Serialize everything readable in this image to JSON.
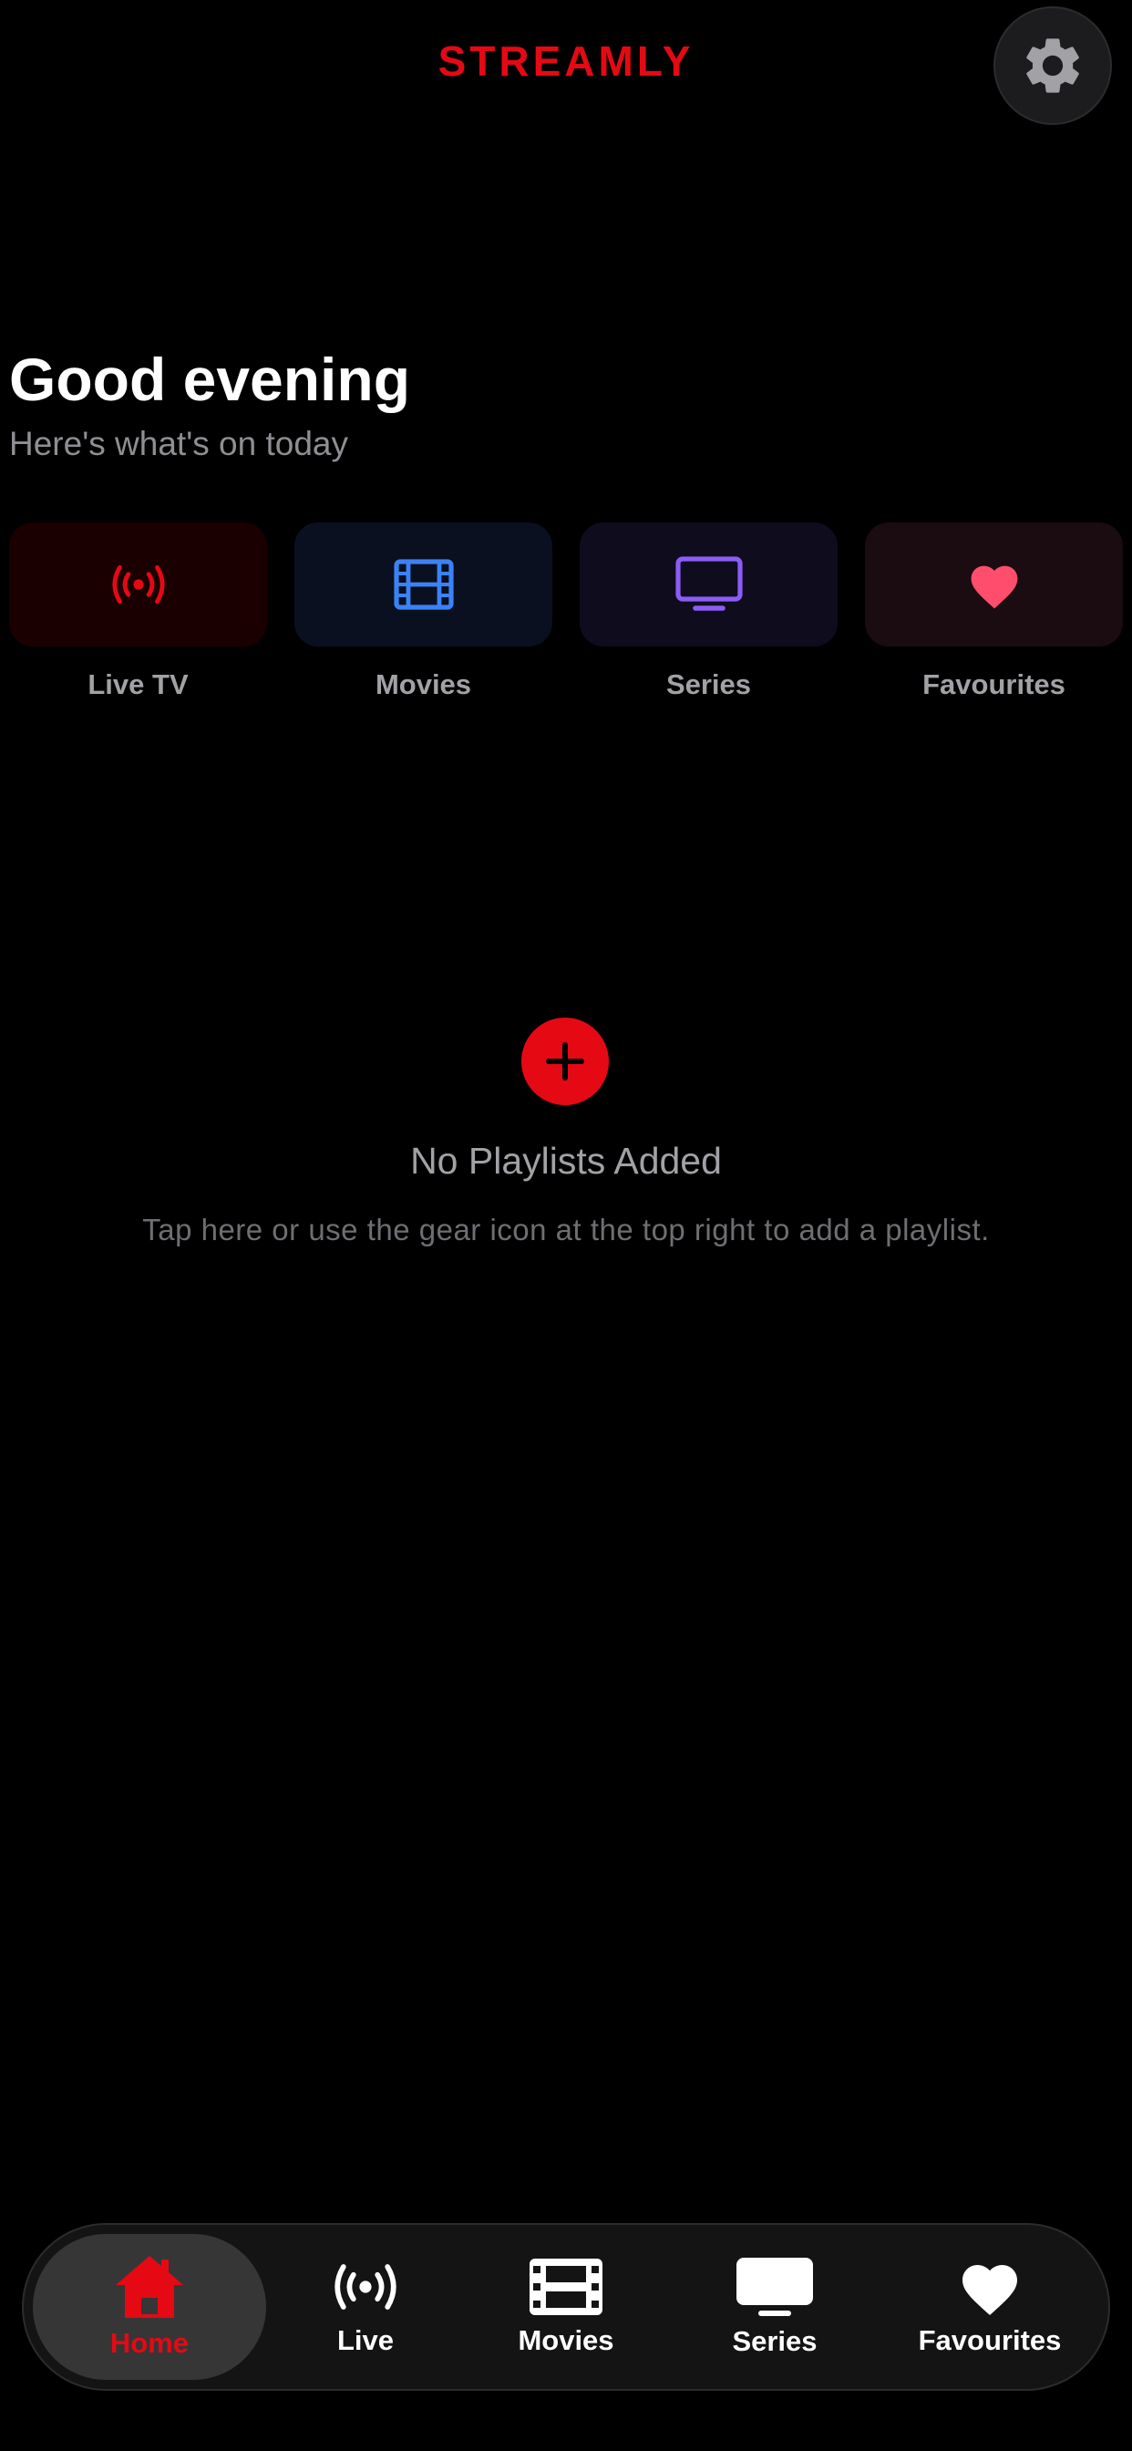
{
  "header": {
    "brand": "STREAMLY",
    "settings_icon": "gear-icon"
  },
  "greeting": {
    "title": "Good evening",
    "subtitle": "Here's what's on today"
  },
  "categories": [
    {
      "label": "Live TV",
      "icon": "broadcast-icon",
      "color": "#e50914",
      "bg": "#1a0000"
    },
    {
      "label": "Movies",
      "icon": "film-icon",
      "color": "#3b82f6",
      "bg": "#0a1020"
    },
    {
      "label": "Series",
      "icon": "tv-icon",
      "color": "#8b5cf6",
      "bg": "#0f0c1e"
    },
    {
      "label": "Favourites",
      "icon": "heart-icon",
      "color": "#ff4d6d",
      "bg": "#1a0c10"
    }
  ],
  "empty_state": {
    "icon": "plus-icon",
    "title": "No Playlists Added",
    "message": "Tap here or use the gear icon at the top right to add a playlist."
  },
  "tabbar": {
    "items": [
      {
        "label": "Home",
        "icon": "home-icon",
        "active": true
      },
      {
        "label": "Live",
        "icon": "broadcast-icon",
        "active": false
      },
      {
        "label": "Movies",
        "icon": "film-icon",
        "active": false
      },
      {
        "label": "Series",
        "icon": "tv-icon",
        "active": false
      },
      {
        "label": "Favourites",
        "icon": "heart-icon",
        "active": false
      }
    ]
  },
  "colors": {
    "accent": "#e50914",
    "background": "#000000"
  }
}
